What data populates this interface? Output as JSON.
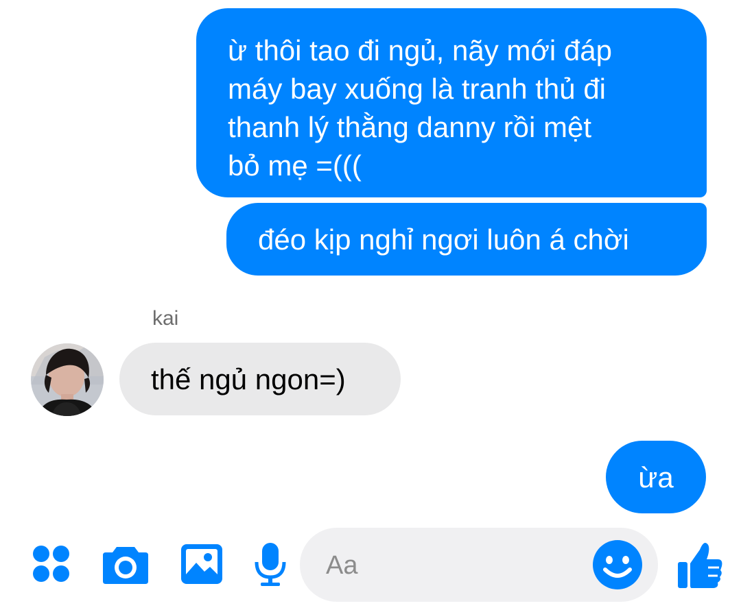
{
  "conversation": {
    "messages": [
      {
        "from": "me",
        "text": "ừ thôi tao đi ngủ, nãy mới đáp\nmáy bay xuống là tranh thủ đi\nthanh lý thằng danny rồi mệt\nbỏ mẹ =((("
      },
      {
        "from": "me",
        "text": "đéo kịp nghỉ ngơi luôn á chời"
      },
      {
        "from": "kai",
        "text": "thế ngủ ngon=)"
      },
      {
        "from": "me",
        "text": "ừa"
      }
    ],
    "contact_name": "kai"
  },
  "composer": {
    "placeholder": "Aa",
    "icons": [
      "apps-icon",
      "camera-icon",
      "gallery-icon",
      "microphone-icon",
      "emoji-icon",
      "thumbs-up-icon"
    ]
  },
  "colors": {
    "accent": "#0084ff",
    "incoming_bubble": "#e9e9ea",
    "input_bg": "#f0f0f2"
  }
}
